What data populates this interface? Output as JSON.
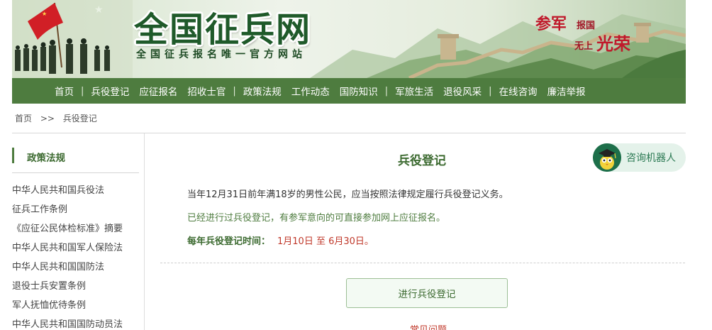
{
  "banner": {
    "title": "全国征兵网",
    "subtitle": "全国征兵报名唯一官方网站",
    "slogan": [
      "参军",
      "报国",
      "无上",
      "光荣"
    ]
  },
  "nav": [
    "首页",
    "兵役登记",
    "应征报名",
    "招收士官",
    "政策法规",
    "工作动态",
    "国防知识",
    "军旅生活",
    "退役风采",
    "在线咨询",
    "廉洁举报"
  ],
  "breadcrumb": [
    "首页",
    ">>",
    "兵役登记"
  ],
  "sidebar": {
    "title": "政策法规",
    "items": [
      "中华人民共和国兵役法",
      "征兵工作条例",
      "《应征公民体检标准》摘要",
      "中华人民共和国军人保险法",
      "中华人民共和国国防法",
      "退役士兵安置条例",
      "军人抚恤优待条例",
      "中华人民共和国国防动员法"
    ]
  },
  "main": {
    "title": "兵役登记",
    "robot_label": "咨询机器人",
    "p1": "当年12月31日前年满18岁的男性公民，应当按照法律规定履行兵役登记义务。",
    "p2": "已经进行过兵役登记，有参军意向的可直接参加网上应征报名。",
    "time_label": "每年兵役登记时间：",
    "time_value": "1月10日 至 6月30日。",
    "register_button": "进行兵役登记",
    "faq_link": "常见问题"
  },
  "colors": {
    "accent": "#4e7c3f",
    "title_green": "#3c6a30",
    "highlight_red": "#c0392b"
  }
}
